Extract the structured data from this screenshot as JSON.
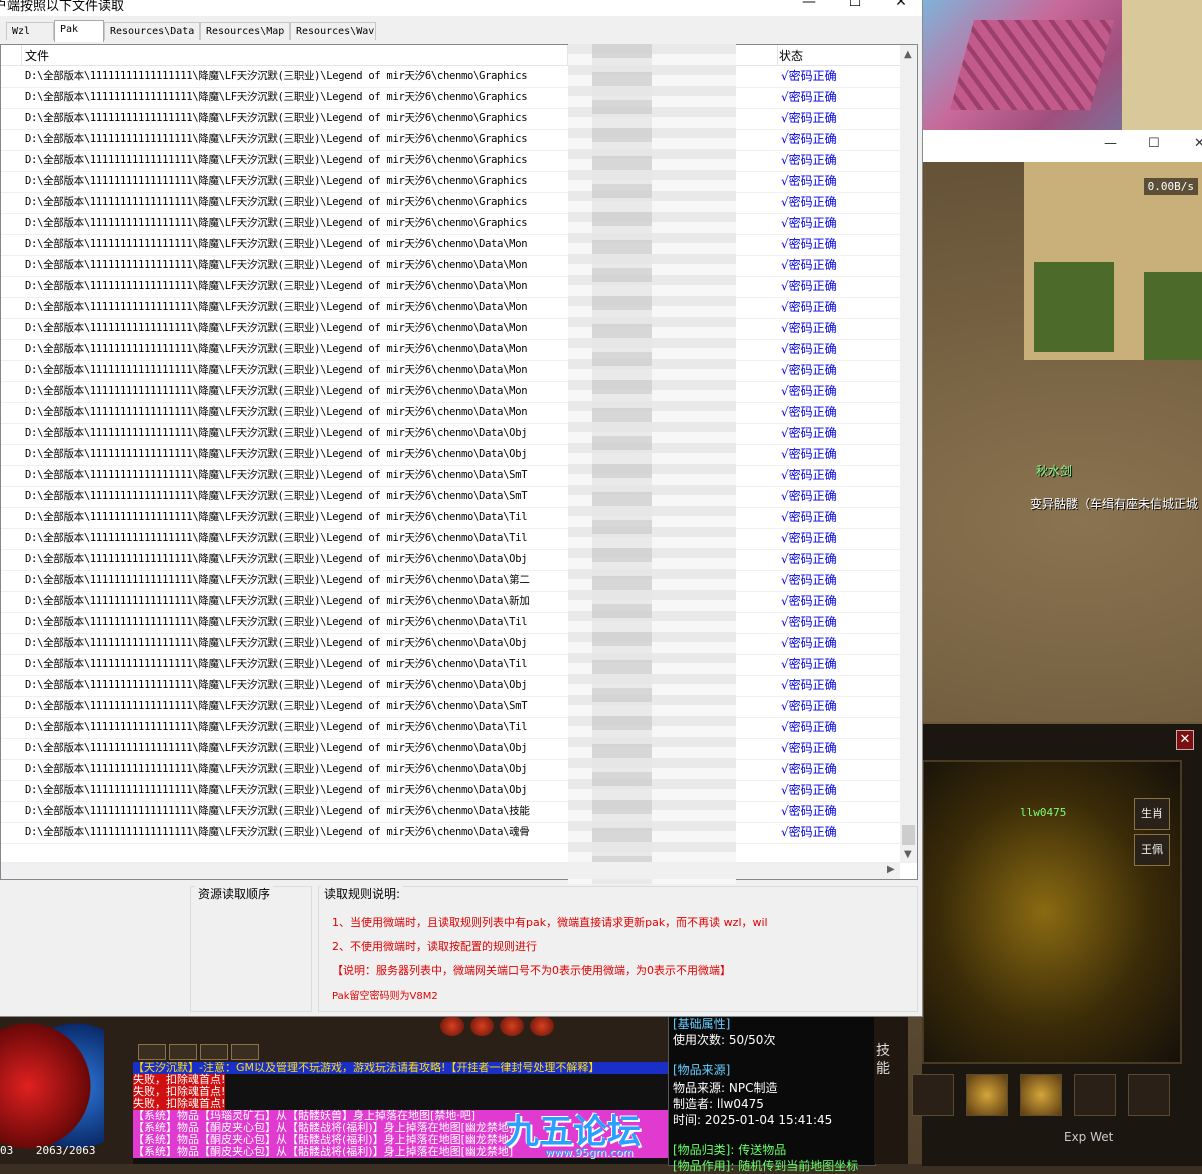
{
  "window": {
    "title": "户端按照以下文件读取",
    "controls": [
      "—",
      "☐",
      "✕"
    ]
  },
  "tabs": [
    {
      "label": "Wzl",
      "active": false
    },
    {
      "label": "Pak",
      "active": true
    },
    {
      "label": "Resources\\Data",
      "active": false
    },
    {
      "label": "Resources\\Map",
      "active": false
    },
    {
      "label": "Resources\\Wav",
      "active": false
    }
  ],
  "list": {
    "columns": {
      "file": "文件",
      "status": "状态"
    },
    "path_prefix": "D:\\全部版本\\11111111111111111\\降魔\\LF天汐沉默(三职业)\\Legend of mir天汐6\\chenmo\\",
    "rows": [
      {
        "file": "D:\\全部版本\\11111111111111111\\降魔\\LF天汐沉默(三职业)\\Legend of mir天汐6\\chenmo\\Graphics",
        "status": "√密码正确"
      },
      {
        "file": "D:\\全部版本\\11111111111111111\\降魔\\LF天汐沉默(三职业)\\Legend of mir天汐6\\chenmo\\Graphics",
        "status": "√密码正确"
      },
      {
        "file": "D:\\全部版本\\11111111111111111\\降魔\\LF天汐沉默(三职业)\\Legend of mir天汐6\\chenmo\\Graphics",
        "status": "√密码正确"
      },
      {
        "file": "D:\\全部版本\\11111111111111111\\降魔\\LF天汐沉默(三职业)\\Legend of mir天汐6\\chenmo\\Graphics",
        "status": "√密码正确"
      },
      {
        "file": "D:\\全部版本\\11111111111111111\\降魔\\LF天汐沉默(三职业)\\Legend of mir天汐6\\chenmo\\Graphics",
        "status": "√密码正确"
      },
      {
        "file": "D:\\全部版本\\11111111111111111\\降魔\\LF天汐沉默(三职业)\\Legend of mir天汐6\\chenmo\\Graphics",
        "status": "√密码正确"
      },
      {
        "file": "D:\\全部版本\\11111111111111111\\降魔\\LF天汐沉默(三职业)\\Legend of mir天汐6\\chenmo\\Graphics",
        "status": "√密码正确"
      },
      {
        "file": "D:\\全部版本\\11111111111111111\\降魔\\LF天汐沉默(三职业)\\Legend of mir天汐6\\chenmo\\Graphics",
        "status": "√密码正确"
      },
      {
        "file": "D:\\全部版本\\11111111111111111\\降魔\\LF天汐沉默(三职业)\\Legend of mir天汐6\\chenmo\\Data\\Mon",
        "status": "√密码正确"
      },
      {
        "file": "D:\\全部版本\\11111111111111111\\降魔\\LF天汐沉默(三职业)\\Legend of mir天汐6\\chenmo\\Data\\Mon",
        "status": "√密码正确"
      },
      {
        "file": "D:\\全部版本\\11111111111111111\\降魔\\LF天汐沉默(三职业)\\Legend of mir天汐6\\chenmo\\Data\\Mon",
        "status": "√密码正确"
      },
      {
        "file": "D:\\全部版本\\11111111111111111\\降魔\\LF天汐沉默(三职业)\\Legend of mir天汐6\\chenmo\\Data\\Mon",
        "status": "√密码正确"
      },
      {
        "file": "D:\\全部版本\\11111111111111111\\降魔\\LF天汐沉默(三职业)\\Legend of mir天汐6\\chenmo\\Data\\Mon",
        "status": "√密码正确"
      },
      {
        "file": "D:\\全部版本\\11111111111111111\\降魔\\LF天汐沉默(三职业)\\Legend of mir天汐6\\chenmo\\Data\\Mon",
        "status": "√密码正确"
      },
      {
        "file": "D:\\全部版本\\11111111111111111\\降魔\\LF天汐沉默(三职业)\\Legend of mir天汐6\\chenmo\\Data\\Mon",
        "status": "√密码正确"
      },
      {
        "file": "D:\\全部版本\\11111111111111111\\降魔\\LF天汐沉默(三职业)\\Legend of mir天汐6\\chenmo\\Data\\Mon",
        "status": "√密码正确"
      },
      {
        "file": "D:\\全部版本\\11111111111111111\\降魔\\LF天汐沉默(三职业)\\Legend of mir天汐6\\chenmo\\Data\\Mon",
        "status": "√密码正确"
      },
      {
        "file": "D:\\全部版本\\11111111111111111\\降魔\\LF天汐沉默(三职业)\\Legend of mir天汐6\\chenmo\\Data\\Obj",
        "status": "√密码正确"
      },
      {
        "file": "D:\\全部版本\\11111111111111111\\降魔\\LF天汐沉默(三职业)\\Legend of mir天汐6\\chenmo\\Data\\Obj",
        "status": "√密码正确"
      },
      {
        "file": "D:\\全部版本\\11111111111111111\\降魔\\LF天汐沉默(三职业)\\Legend of mir天汐6\\chenmo\\Data\\SmT",
        "status": "√密码正确"
      },
      {
        "file": "D:\\全部版本\\11111111111111111\\降魔\\LF天汐沉默(三职业)\\Legend of mir天汐6\\chenmo\\Data\\SmT",
        "status": "√密码正确"
      },
      {
        "file": "D:\\全部版本\\11111111111111111\\降魔\\LF天汐沉默(三职业)\\Legend of mir天汐6\\chenmo\\Data\\Til",
        "status": "√密码正确"
      },
      {
        "file": "D:\\全部版本\\11111111111111111\\降魔\\LF天汐沉默(三职业)\\Legend of mir天汐6\\chenmo\\Data\\Til",
        "status": "√密码正确"
      },
      {
        "file": "D:\\全部版本\\11111111111111111\\降魔\\LF天汐沉默(三职业)\\Legend of mir天汐6\\chenmo\\Data\\Obj",
        "status": "√密码正确"
      },
      {
        "file": "D:\\全部版本\\11111111111111111\\降魔\\LF天汐沉默(三职业)\\Legend of mir天汐6\\chenmo\\Data\\第二",
        "status": "√密码正确"
      },
      {
        "file": "D:\\全部版本\\11111111111111111\\降魔\\LF天汐沉默(三职业)\\Legend of mir天汐6\\chenmo\\Data\\新加",
        "status": "√密码正确"
      },
      {
        "file": "D:\\全部版本\\11111111111111111\\降魔\\LF天汐沉默(三职业)\\Legend of mir天汐6\\chenmo\\Data\\Til",
        "status": "√密码正确"
      },
      {
        "file": "D:\\全部版本\\11111111111111111\\降魔\\LF天汐沉默(三职业)\\Legend of mir天汐6\\chenmo\\Data\\Obj",
        "status": "√密码正确"
      },
      {
        "file": "D:\\全部版本\\11111111111111111\\降魔\\LF天汐沉默(三职业)\\Legend of mir天汐6\\chenmo\\Data\\Til",
        "status": "√密码正确"
      },
      {
        "file": "D:\\全部版本\\11111111111111111\\降魔\\LF天汐沉默(三职业)\\Legend of mir天汐6\\chenmo\\Data\\Obj",
        "status": "√密码正确"
      },
      {
        "file": "D:\\全部版本\\11111111111111111\\降魔\\LF天汐沉默(三职业)\\Legend of mir天汐6\\chenmo\\Data\\SmT",
        "status": "√密码正确"
      },
      {
        "file": "D:\\全部版本\\11111111111111111\\降魔\\LF天汐沉默(三职业)\\Legend of mir天汐6\\chenmo\\Data\\Til",
        "status": "√密码正确"
      },
      {
        "file": "D:\\全部版本\\11111111111111111\\降魔\\LF天汐沉默(三职业)\\Legend of mir天汐6\\chenmo\\Data\\Obj",
        "status": "√密码正确"
      },
      {
        "file": "D:\\全部版本\\11111111111111111\\降魔\\LF天汐沉默(三职业)\\Legend of mir天汐6\\chenmo\\Data\\Obj",
        "status": "√密码正确"
      },
      {
        "file": "D:\\全部版本\\11111111111111111\\降魔\\LF天汐沉默(三职业)\\Legend of mir天汐6\\chenmo\\Data\\Obj",
        "status": "√密码正确"
      },
      {
        "file": "D:\\全部版本\\11111111111111111\\降魔\\LF天汐沉默(三职业)\\Legend of mir天汐6\\chenmo\\Data\\技能",
        "status": "√密码正确"
      },
      {
        "file": "D:\\全部版本\\11111111111111111\\降魔\\LF天汐沉默(三职业)\\Legend of mir天汐6\\chenmo\\Data\\魂骨",
        "status": "√密码正确"
      }
    ]
  },
  "bottom": {
    "load_order_title": "资源读取顺序",
    "rules_title": "读取规则说明:",
    "rules": [
      "1、当使用微端时，且读取规则列表中有pak，微端直接请求更新pak，而不再读 wzl，wil",
      "2、不使用微端时，读取按配置的规则进行",
      "【说明：服务器列表中，微端网关端口号不为0表示使用微端，为0表示不用微端】",
      "Pak留空密码则为V8M2"
    ]
  },
  "game": {
    "second_window_controls": [
      "—",
      "☐",
      "✕"
    ],
    "minimap_speed": "0.00B/s",
    "player_name": "秋水剑",
    "npc_label": "变异骷髅（车缉有座未信城正城",
    "hp_mp": "2063/2063",
    "hp_prefix": "03",
    "char_panel": {
      "close": "✕",
      "player": "llw0475",
      "tabs": [
        "生肖",
        "王佩"
      ]
    },
    "chat": {
      "system_notice": "【天汐沉默】-注意：GM以及管理不玩游戏，游戏玩法请看攻略!【开挂者一律封号处理不解释】",
      "fails": [
        "失败，扣除魂首点!",
        "失败，扣除魂首点!",
        "失败，扣除魂首点!"
      ],
      "drops": [
        "【系统】物品【玛瑙灵矿石】从【骷髅妖兽】身上掉落在地图[禁地·吧]",
        "【系统】物品【酮皮夹心包】从【骷髅战将(福利)】身上掉落在地图[幽龙禁地]",
        "【系统】物品【酮皮夹心包】从【骷髅战将(福利)】身上掉落在地图[幽龙禁地]",
        "【系统】物品【酮皮夹心包】从【骷髅战将(福利)】身上掉落在地图[幽龙禁地]"
      ]
    },
    "logo": {
      "text": "九五论坛",
      "url": "www.95gm.com"
    },
    "tooltip": {
      "base_attr": "[基础属性]",
      "uses": "使用次数: 50/50次",
      "source_head": "[物品来源]",
      "source": "物品来源: NPC制造",
      "maker": "制造者: llw0475",
      "time": "时间: 2025-01-04 15:41:45",
      "category": "[物品归类]: 传送物品",
      "effect": "[物品作用]: 随机传到当前地图坐标"
    },
    "skill_label": "技能",
    "exp_label": "Exp  Wet"
  },
  "colors": {
    "status_blue": "#0000e0",
    "rule_red": "#e00000",
    "window_bg": "#f0f0f0"
  }
}
